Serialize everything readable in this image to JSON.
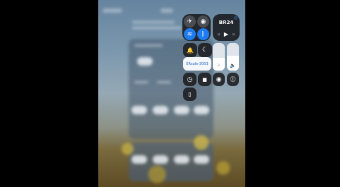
{
  "control_center": {
    "connectivity": {
      "airplane": {
        "icon": "airplane-icon",
        "symbol": "✈"
      },
      "cellular": {
        "icon": "cellular-data-icon",
        "symbol": "◉"
      },
      "wifi": {
        "icon": "wifi-icon",
        "symbol": "≋"
      },
      "bluetooth": {
        "icon": "bluetooth-icon",
        "symbol": "ᛒ"
      }
    },
    "media": {
      "title": "BR24",
      "rewind_symbol": "«",
      "play_symbol": "▶",
      "forward_symbol": "»",
      "airplay_symbol": "◎"
    },
    "bell_symbol": "🔔",
    "moon_symbol": "☾",
    "hotspot_label": "ERsale-3003",
    "brightness": {
      "level": 0.45,
      "symbol": "☼"
    },
    "volume": {
      "level": 0.55,
      "symbol": "🔈"
    },
    "timer_symbol": "◷",
    "camera_symbol": "■",
    "record_symbol": "◉",
    "accessibility_symbol": "⓵",
    "remote_symbol": "▯"
  },
  "colors": {
    "accent": "#1e7bf0",
    "tile": "#1a1c20"
  }
}
